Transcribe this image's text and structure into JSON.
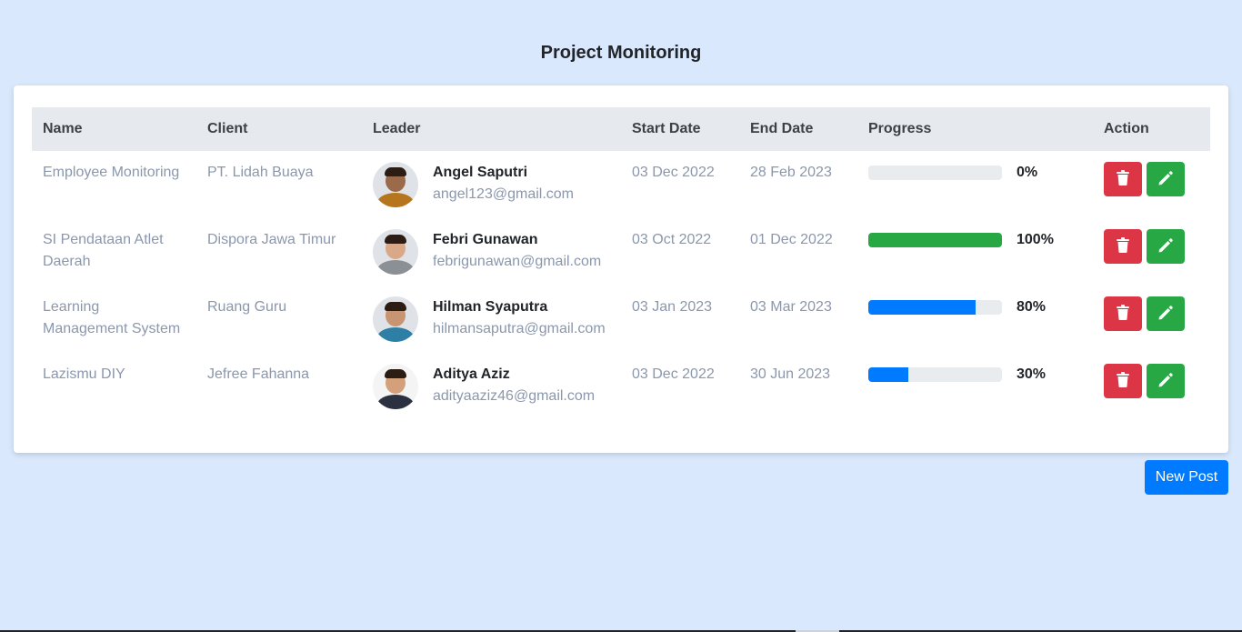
{
  "page": {
    "title": "Project Monitoring"
  },
  "table": {
    "headers": [
      "Name",
      "Client",
      "Leader",
      "Start Date",
      "End Date",
      "Progress",
      "Action"
    ],
    "rows": [
      {
        "name": "Employee Monitoring",
        "client": "PT. Lidah Buaya",
        "leader_name": "Angel Saputri",
        "leader_email": "angel123@gmail.com",
        "start_date": "03 Dec 2022",
        "end_date": "28 Feb 2023",
        "progress_label": "0%",
        "progress_value": 0,
        "progress_color": "#e9ecef",
        "avatar_shirt": "#b5761e",
        "avatar_skin": "#9a6a4a"
      },
      {
        "name": "SI Pendataan Atlet Daerah",
        "client": "Dispora Jawa Timur",
        "leader_name": "Febri Gunawan",
        "leader_email": "febrigunawan@gmail.com",
        "start_date": "03 Oct 2022",
        "end_date": "01 Dec 2022",
        "progress_label": "100%",
        "progress_value": 100,
        "progress_color": "#28a745",
        "avatar_shirt": "#8a9096",
        "avatar_skin": "#d8a888"
      },
      {
        "name": "Learning Management System",
        "client": "Ruang Guru",
        "leader_name": "Hilman Syaputra",
        "leader_email": "hilmansaputra@gmail.com",
        "start_date": "03 Jan 2023",
        "end_date": "03 Mar 2023",
        "progress_label": "80%",
        "progress_value": 80,
        "progress_color": "#007bff",
        "avatar_shirt": "#2e7fa6",
        "avatar_skin": "#c89572"
      },
      {
        "name": "Lazismu DIY",
        "client": "Jefree Fahanna",
        "leader_name": "Aditya Aziz",
        "leader_email": "adityaaziz46@gmail.com",
        "start_date": "03 Dec 2022",
        "end_date": "30 Jun 2023",
        "progress_label": "30%",
        "progress_value": 30,
        "progress_color": "#007bff",
        "avatar_shirt": "#2b3140",
        "avatar_skin": "#d4a07c"
      }
    ]
  },
  "actions": {
    "delete_icon": "trash-icon",
    "edit_icon": "pencil-icon"
  },
  "footer": {
    "new_post_label": "New Post"
  },
  "colors": {
    "background": "#d9e8fc",
    "delete": "#dc3545",
    "edit": "#28a745",
    "primary": "#007bff"
  }
}
